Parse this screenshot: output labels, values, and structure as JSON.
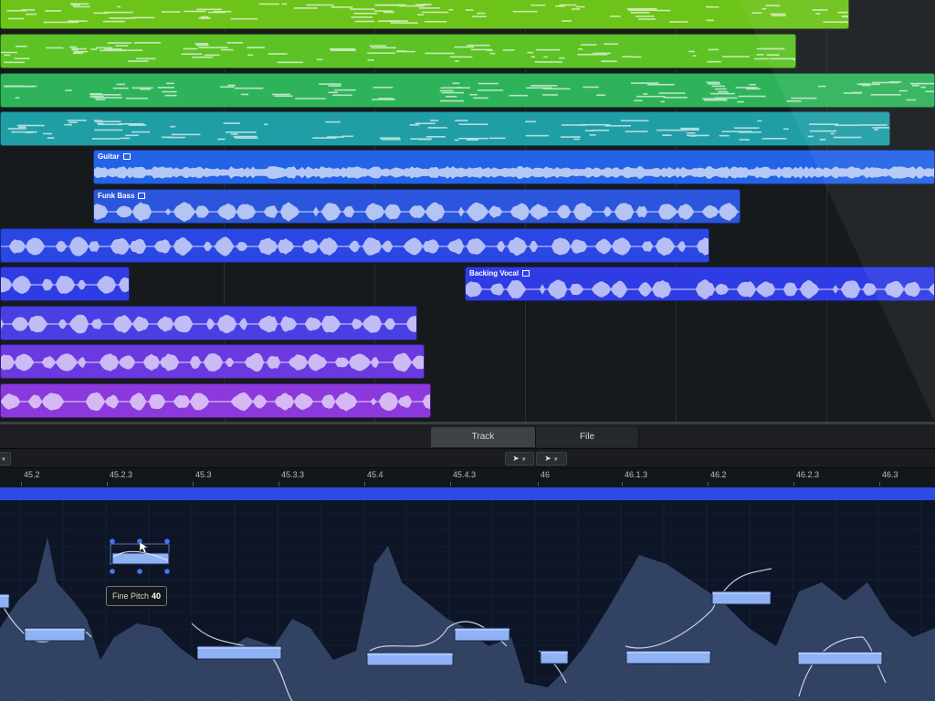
{
  "colors": {
    "arrange_bg": "#171a1d",
    "editor_bg": "#0d1526",
    "ruler_bar": "#2d49e6",
    "note_fill": "#8fb2f5",
    "pitch_fill": "#3a4a6e",
    "selection_handle": "#4a72ff"
  },
  "tracks": [
    {
      "name": "",
      "kind": "midi",
      "color": "#6cc31a"
    },
    {
      "name": "",
      "kind": "midi",
      "color": "#5cc225"
    },
    {
      "name": "",
      "kind": "midi",
      "color": "#2fb35a"
    },
    {
      "name": "",
      "kind": "midi",
      "color": "#1f9ea5"
    },
    {
      "name": "Guitar",
      "kind": "audio",
      "color": "#2463e6"
    },
    {
      "name": "Funk Bass",
      "kind": "audio",
      "color": "#2a55dc"
    },
    {
      "name": "",
      "kind": "audio",
      "color": "#2b47e3"
    },
    {
      "name": "",
      "kind": "audio",
      "color": "#2f3ce4"
    },
    {
      "name": "Backing Vocal",
      "kind": "audio",
      "color": "#2f3ce4"
    },
    {
      "name": "",
      "kind": "audio",
      "color": "#4a3fe2"
    },
    {
      "name": "",
      "kind": "audio",
      "color": "#6a3ae0"
    },
    {
      "name": "",
      "kind": "audio",
      "color": "#8b38dd"
    }
  ],
  "editor": {
    "tabs": [
      "Track",
      "File"
    ],
    "active_tab": "Track",
    "ruler_ticks": [
      "45.2",
      "45.2.3",
      "45.3",
      "45.3.3",
      "45.4",
      "45.4.3",
      "46",
      "46.1.3",
      "46.2",
      "46.2.3",
      "46.3"
    ],
    "tooltip": {
      "label": "Fine Pitch",
      "value": "40"
    }
  }
}
